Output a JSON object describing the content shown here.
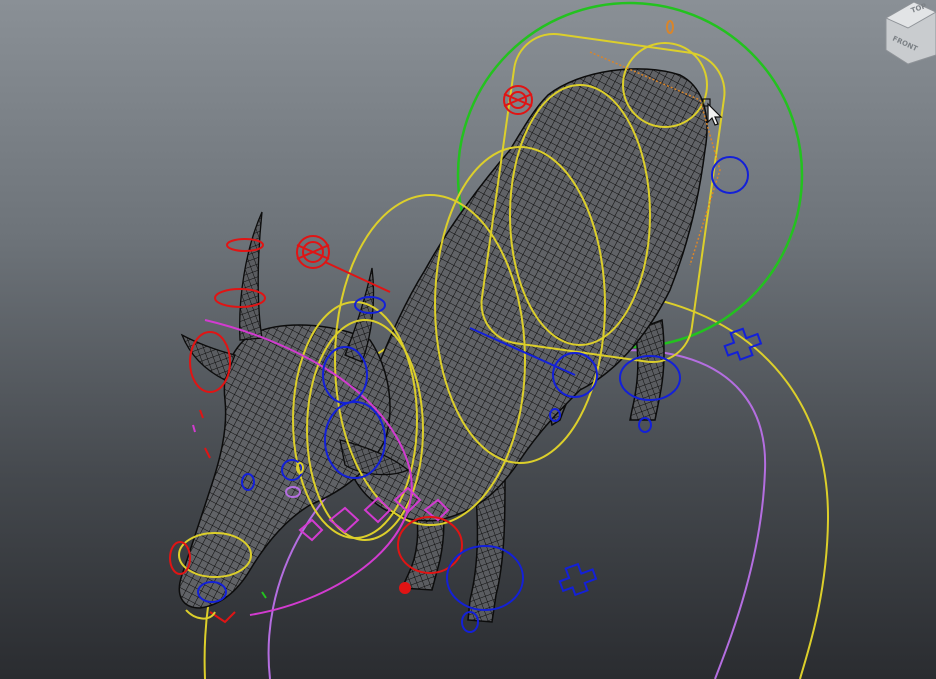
{
  "viewport": {
    "background_top": "#8a9096",
    "background_bottom": "#2a2c30"
  },
  "viewcube": {
    "top_label": "TOP",
    "front_label": "FRONT"
  },
  "model": {
    "mesh_fill": "#5c5e61",
    "wire_color": "#0d0d0d"
  },
  "rig_colors": {
    "yellow": "#dccf2b",
    "green": "#23c21f",
    "blue": "#1320d8",
    "red": "#e01414",
    "magenta": "#d23bd0",
    "orange": "#d9852a",
    "violet": "#b46ee0"
  }
}
